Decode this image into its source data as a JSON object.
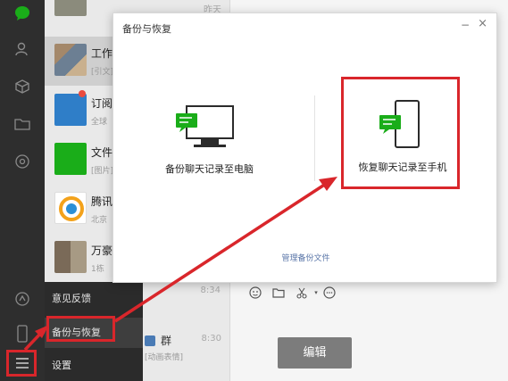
{
  "chat_list": {
    "items": [
      {
        "name": "",
        "subtitle": "",
        "time": "昨天"
      },
      {
        "name": "工作",
        "subtitle": "[引文]",
        "time": ""
      },
      {
        "name": "订阅",
        "subtitle": "全球",
        "time": ""
      },
      {
        "name": "文件",
        "subtitle": "[图片]",
        "time": ""
      },
      {
        "name": "腾讯",
        "subtitle": "北京",
        "time": ""
      },
      {
        "name": "万豪",
        "subtitle": "1栋",
        "time": ""
      }
    ],
    "bottom_chat": {
      "name": "群",
      "subtitle": "[动画表情]",
      "time": "8:30"
    },
    "menu_time": "8:34"
  },
  "menu": {
    "feedback": "意见反馈",
    "backup_restore": "备份与恢复",
    "settings": "设置"
  },
  "dialog": {
    "title": "备份与恢复",
    "backup_to_pc": "备份聊天记录至电脑",
    "restore_to_phone": "恢复聊天记录至手机",
    "manage_files": "管理备份文件"
  },
  "edit_button": "编辑",
  "colors": {
    "highlight_red": "#d9262b",
    "wechat_green": "#1aad19",
    "nav_dark": "#2e2e2e"
  }
}
